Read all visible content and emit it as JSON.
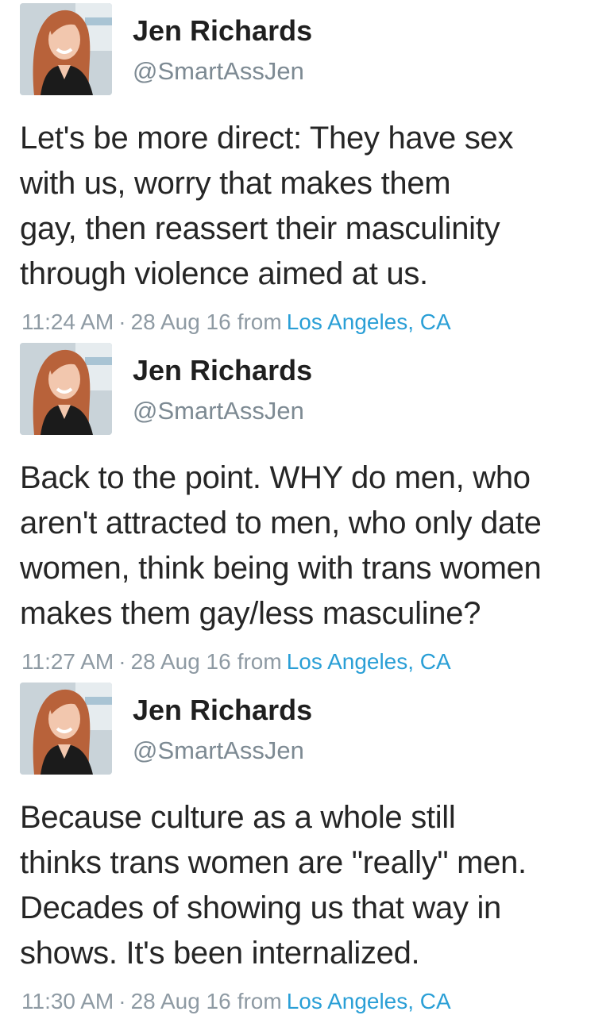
{
  "tweets": [
    {
      "user": {
        "name": "Jen Richards",
        "handle": "@SmartAssJen",
        "avatar_icon": "profile-photo"
      },
      "text_lines": [
        "Let's be more direct: They have sex",
        "with us, worry that makes them",
        "gay, then reassert their masculinity",
        "through violence aimed at us."
      ],
      "time": "11:24 AM",
      "separator": "·",
      "date": "28 Aug 16",
      "from_label": "from",
      "location": "Los Angeles, CA"
    },
    {
      "user": {
        "name": "Jen Richards",
        "handle": "@SmartAssJen",
        "avatar_icon": "profile-photo"
      },
      "text_lines": [
        "Back to the point. WHY do men, who",
        "aren't attracted to men, who only date",
        "women, think being with trans women",
        "makes them gay/less masculine?"
      ],
      "time": "11:27 AM",
      "separator": "·",
      "date": "28 Aug 16",
      "from_label": "from",
      "location": "Los Angeles, CA"
    },
    {
      "user": {
        "name": "Jen Richards",
        "handle": "@SmartAssJen",
        "avatar_icon": "profile-photo"
      },
      "text_lines": [
        "Because culture as a whole still",
        "thinks trans women are \"really\" men.",
        "Decades of showing us that way in",
        "shows. It's been internalized."
      ],
      "time": "11:30 AM",
      "separator": "·",
      "date": "28 Aug 16",
      "from_label": "from",
      "location": "Los Angeles, CA"
    }
  ],
  "colors": {
    "name": "#1f1f1f",
    "handle": "#7d8a93",
    "meta": "#8e9aa3",
    "link": "#2a9fd6",
    "background": "#ffffff"
  }
}
